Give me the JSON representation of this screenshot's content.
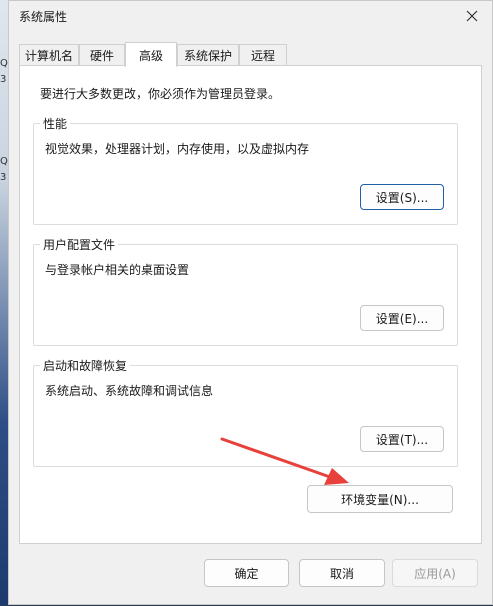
{
  "window": {
    "title": "系统属性"
  },
  "desktop": {
    "icon_glyphs": [
      "Q",
      "3",
      "Q",
      "3"
    ]
  },
  "tabs": [
    {
      "label": "计算机名",
      "active": false
    },
    {
      "label": "硬件",
      "active": false
    },
    {
      "label": "高级",
      "active": true
    },
    {
      "label": "系统保护",
      "active": false
    },
    {
      "label": "远程",
      "active": false
    }
  ],
  "advanced": {
    "admin_notice": "要进行大多数更改，你必须作为管理员登录。",
    "performance": {
      "title": "性能",
      "description": "视觉效果，处理器计划，内存使用，以及虚拟内存",
      "settings_button": "设置(S)..."
    },
    "user_profiles": {
      "title": "用户配置文件",
      "description": "与登录帐户相关的桌面设置",
      "settings_button": "设置(E)..."
    },
    "startup_recovery": {
      "title": "启动和故障恢复",
      "description": "系统启动、系统故障和调试信息",
      "settings_button": "设置(T)..."
    },
    "env_vars_button": "环境变量(N)..."
  },
  "footer": {
    "ok": "确定",
    "cancel": "取消",
    "apply": "应用(A)"
  },
  "colors": {
    "accent_border": "#1f5fa8",
    "annotation_arrow": "#e8403a"
  }
}
